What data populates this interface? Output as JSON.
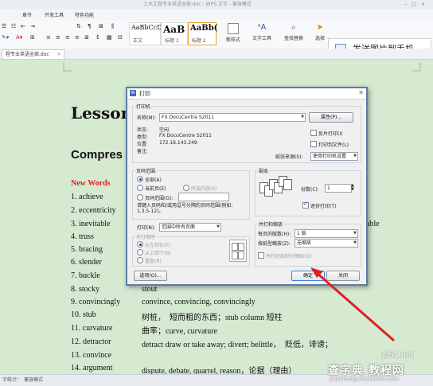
{
  "window": {
    "title": "土木工程专业英语全部.doc - WPS 文字 - 兼容模式"
  },
  "menu": [
    "章节",
    "开发工具",
    "特色功能"
  ],
  "ribbon": {
    "styles": [
      {
        "preview": "AaBbCcD",
        "label": "正文"
      },
      {
        "preview": "AaB",
        "label": "标题 1"
      },
      {
        "preview": "AaBb(",
        "label": "标题 2"
      }
    ],
    "new_style": "新样式",
    "text_tools": "文字工具",
    "find_replace": "查找替换",
    "select": "选择"
  },
  "tab": {
    "label": "程专业英语全部.doc"
  },
  "send_button": "发送图片到手机",
  "document": {
    "lesson": "Lesson",
    "compress": "Compres",
    "new_words": "New Words",
    "right_fragment": "dable",
    "words": [
      {
        "word": "1. achieve",
        "def": ""
      },
      {
        "word": "2. eccentricity",
        "def": ""
      },
      {
        "word": "3. inevitable",
        "def": ""
      },
      {
        "word": "4. truss",
        "def": ""
      },
      {
        "word": "5. bracing",
        "def": ""
      },
      {
        "word": "6. slender",
        "def": ""
      },
      {
        "word": "7. buckle",
        "def": ""
      },
      {
        "word": "8. stocky",
        "def": "stout"
      },
      {
        "word": "9. convincingly",
        "def": "convince, convincing, convincingly"
      },
      {
        "word": "10. stub",
        "def": "树桩，　短而粗的东西；stub column  短柱"
      },
      {
        "word": "11. curvature",
        "def": "曲率；curve, curvature"
      },
      {
        "word": "12. detractor",
        "def": "detract    draw or take away; divert; belittle，　贬低，诽谤；"
      },
      {
        "word": "13. convince",
        "def": ""
      },
      {
        "word": "14. argument",
        "def": "dispute, debate, quarrel, reason，论据（理由）"
      }
    ]
  },
  "status_bar": {
    "text": "字统计：　兼容模式"
  },
  "watermark": {
    "site": "jb51.net",
    "brand": "查字典 教程网",
    "url": "jiaocheng.chazidian.com"
  },
  "dialog": {
    "title": "打印",
    "printer_group": "打印机",
    "name_label": "名称(M):",
    "name_value": "FX DocuCentre S2011",
    "properties_button": "属性(P)...",
    "status_label": "状态:",
    "status_value": "空闲",
    "type_label": "类型:",
    "type_value": "FX DocuCentre S2011",
    "location_label": "位置:",
    "location_value": "172.16.143.249",
    "comment_label": "备注:",
    "reverse_print": "反片打印(I)",
    "print_to_file": "打印到文件(L)",
    "paper_source_label": "纸张来源(S):",
    "paper_source_value": "使用打印机设置",
    "page_range_group": "页码范围",
    "all": "全部(A)",
    "current_page": "当前页(E)",
    "selection": "所选内容(S)",
    "page_range": "页码范围(G):",
    "range_hint": "请键入页码和/或用逗号分隔的页码范围(例如: 1,3,5-12)。",
    "copies_group": "副本",
    "copies_label": "份数(C):",
    "copies_value": "1",
    "collate": "逐份打印(T)",
    "print_label": "打印(N):",
    "print_value": "范围中所有页面",
    "order_group": "并打顺序",
    "order_options": [
      "从左到右(F)",
      "从上到下(B)",
      "重复(R)"
    ],
    "merge_group": "并打和缩放",
    "pages_per_sheet_label": "每页的版数(H):",
    "pages_per_sheet_value": "1 版",
    "scale_label": "按纸型缩放(Z):",
    "scale_value": "无缩放",
    "merge_border": "并打时绘制分隔线(D)",
    "options_button": "选项(O)...",
    "ok_button": "确定",
    "cancel_button": "关闭"
  },
  "colors": {
    "doc_background": "#d6ead2",
    "new_words": "#e0201b",
    "dialog_border": "#5e7da6",
    "annotation_arrow": "#e02020"
  }
}
